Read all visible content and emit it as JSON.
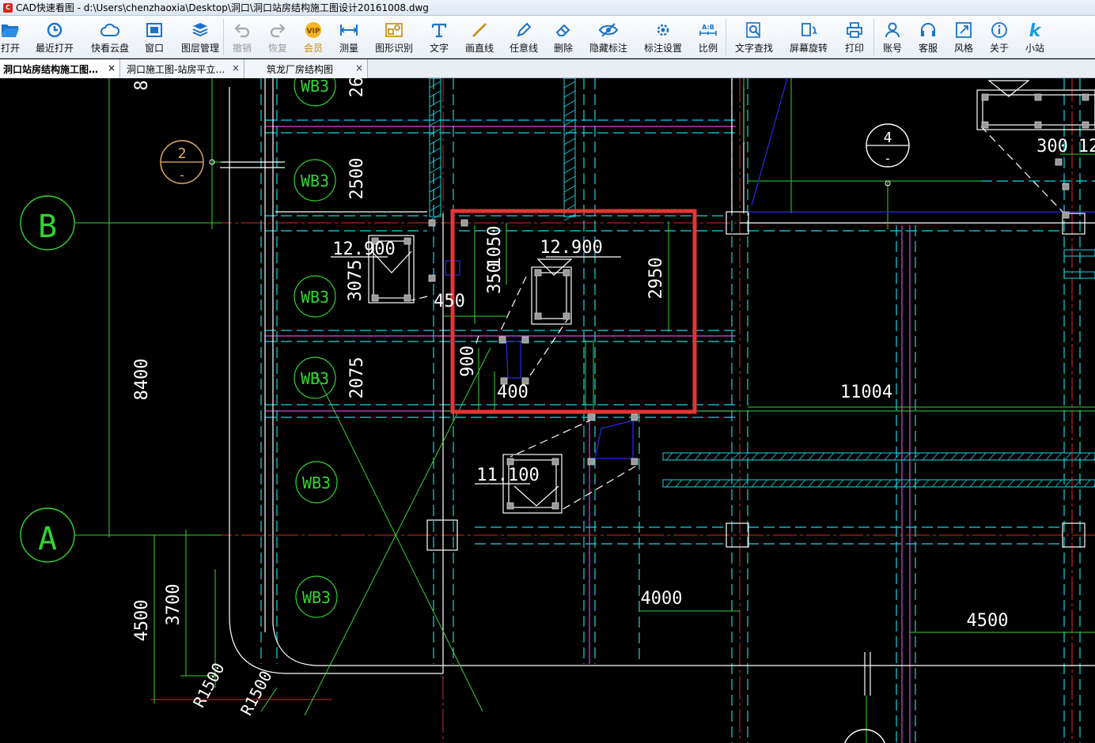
{
  "window": {
    "title": "CAD快速看图 - d:\\Users\\chenzhaoxia\\Desktop\\洞口\\洞口站房结构施工图设计20161008.dwg"
  },
  "toolbar": {
    "open": "打开",
    "recent": "最近打开",
    "cloud": "快看云盘",
    "window": "窗口",
    "layers": "图层管理",
    "undo": "撤销",
    "redo": "恢复",
    "vip": "会员",
    "measure": "测量",
    "recognize": "图形识别",
    "text": "文字",
    "line": "画直线",
    "freeline": "任意线",
    "delete": "删除",
    "hide_dim": "隐藏标注",
    "dim_settings": "标注设置",
    "scale": "比例",
    "find_text": "文字查找",
    "rotate": "屏幕旋转",
    "print": "打印",
    "account": "账号",
    "service": "客服",
    "style": "风格",
    "about": "关于",
    "site": "小站",
    "vip_badge": "VIP",
    "scale_badge": "A:B",
    "site_badge": "k"
  },
  "tabs": [
    {
      "label": "洞口站房结构施工图…",
      "active": true
    },
    {
      "label": "洞口施工图-站房平立…",
      "active": false
    },
    {
      "label": "筑龙厂房结构图",
      "active": false
    }
  ],
  "tab_close": "×",
  "drawing": {
    "axis_b": "B",
    "axis_a": "A",
    "bubble_2": "2",
    "bubble_4": "4",
    "bubble_dash": "-",
    "wb3": "WB3",
    "dim_2500": "2500",
    "dim_2075": "2075",
    "dim_8400": "8400",
    "dim_4500_left": "4500",
    "dim_3700": "3700",
    "dim_3075": "3075",
    "dim_1050": "1050",
    "dim_350": "350",
    "dim_450": "450",
    "dim_2950": "2950",
    "dim_900": "900",
    "dim_400": "400",
    "dim_11004": "11004",
    "dim_4000": "4000",
    "dim_4500_right": "4500",
    "dim_300": "300",
    "dim_12": "12",
    "elev_12900_a": "12.900",
    "elev_12900_b": "12.900",
    "elev_11100": "11.100",
    "r1500_a": "R1500",
    "r1500_b": "R1500",
    "dim_top": "26",
    "dim_top_left": "8"
  },
  "colors": {
    "highlight": "#e83434",
    "axis": "#31d631",
    "beam_cyan": "#1fd3e0",
    "magenta": "#d64ad6",
    "red_line": "#d42a2a",
    "blue": "#2b2be8",
    "white": "#ffffff",
    "bubble_orange": "#e8b06a"
  }
}
